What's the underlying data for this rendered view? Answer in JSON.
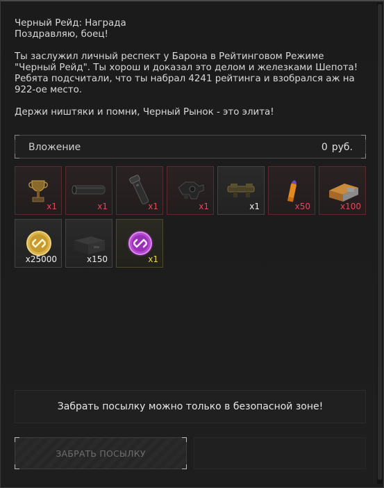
{
  "message": {
    "title": "Черный Рейд: Награда",
    "greeting": "Поздравляю, боец!",
    "body_lines": [
      "Ты заслужил личный респект у Барона в Рейтинговом Режиме",
      "\"Черный Рейд\". Ты хорош и доказал это делом и железками Шепота!",
      "Ребята подсчитали, что ты набрал 4241 рейтинга и взобрался аж на",
      "922-ое место."
    ],
    "closing": "Держи ништяки и помни, Черный Рынок - это элита!"
  },
  "investment": {
    "label": "Вложение",
    "amount": "0",
    "currency": "руб."
  },
  "items": [
    {
      "icon": "trophy-cup-icon",
      "qty": "x1",
      "rarity": "red"
    },
    {
      "icon": "suppressor-icon",
      "qty": "x1",
      "rarity": "red"
    },
    {
      "icon": "flashlight-icon",
      "qty": "x1",
      "rarity": "red"
    },
    {
      "icon": "weapon-part-icon",
      "qty": "x1",
      "rarity": "red"
    },
    {
      "icon": "rifle-scope-icon",
      "qty": "x1",
      "rarity": "gray"
    },
    {
      "icon": "cartridge-icon",
      "qty": "x50",
      "rarity": "red"
    },
    {
      "icon": "ammo-box-icon",
      "qty": "x100",
      "rarity": "red"
    },
    {
      "icon": "gold-chain-coin-icon",
      "qty": "x25000",
      "rarity": "gray"
    },
    {
      "icon": "crate-icon",
      "qty": "x150",
      "rarity": "gray"
    },
    {
      "icon": "purple-chain-coin-icon",
      "qty": "x1",
      "rarity": "yellow"
    }
  ],
  "notice": "Забрать посылку можно только в безопасной зоне!",
  "claim_button": "ЗАБРАТЬ ПОСЫЛКУ",
  "colors": {
    "qty_red": "#e4485a",
    "qty_white": "#f0f0f0",
    "qty_yellow": "#e8d64a",
    "text": "#d9d9d9",
    "background": "#1c1c1c"
  }
}
